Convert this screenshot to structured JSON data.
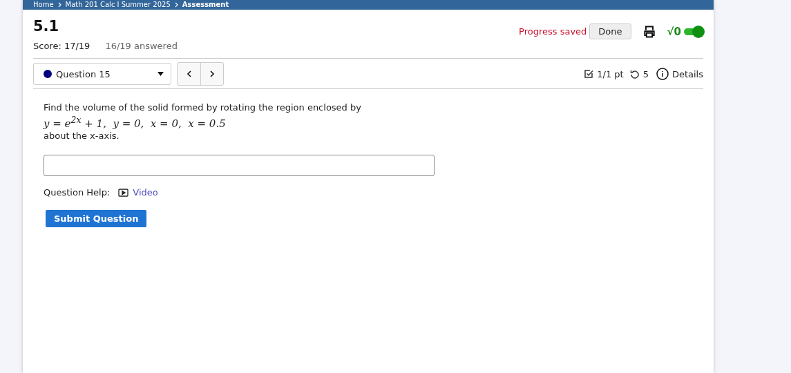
{
  "breadcrumb": [
    "Home",
    "Math 201 Calc I Summer 2025",
    "Assessment"
  ],
  "assessment": {
    "title": "5.1",
    "score": "Score: 17/19",
    "answered": "16/19 answered"
  },
  "status": {
    "progress": "Progress saved",
    "done_button": "Done",
    "math_toggle": {
      "label": "√0",
      "on": true
    }
  },
  "question_select": {
    "label": "Question 15",
    "color": "#000080"
  },
  "question_meta": {
    "points": "1/1 pt",
    "attempts": "5",
    "details": "Details"
  },
  "question": {
    "prompt": "Find the volume of the solid formed by rotating the region enclosed by",
    "math": "y = e$^{2x}$ + 1,  y = 0,  x = 0,  x = 0.5",
    "suffix": "about the x-axis."
  },
  "help": {
    "label": "Question Help:",
    "link": "Video"
  },
  "submit_button": "Submit Question"
}
